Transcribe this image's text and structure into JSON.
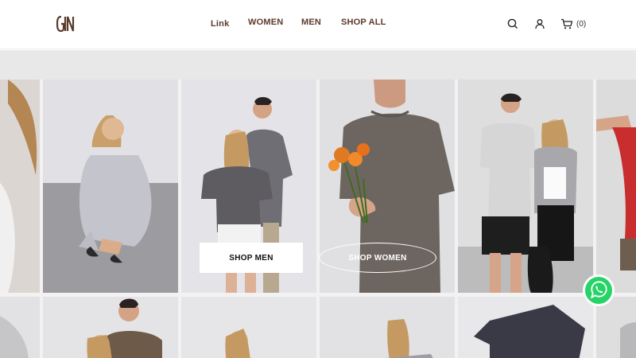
{
  "header": {
    "logo_text": "GGN",
    "nav": [
      "Link",
      "WOMEN",
      "MEN",
      "SHOP ALL"
    ],
    "cart_count": "(0)",
    "icons": [
      "search-icon",
      "user-icon",
      "cart-icon"
    ]
  },
  "hero": {
    "shop_men_label": "SHOP MEN",
    "shop_women_label": "SHOP WOMEN"
  },
  "colors": {
    "brand_brown": "#5a3a2a",
    "whatsapp_green": "#25d366"
  }
}
